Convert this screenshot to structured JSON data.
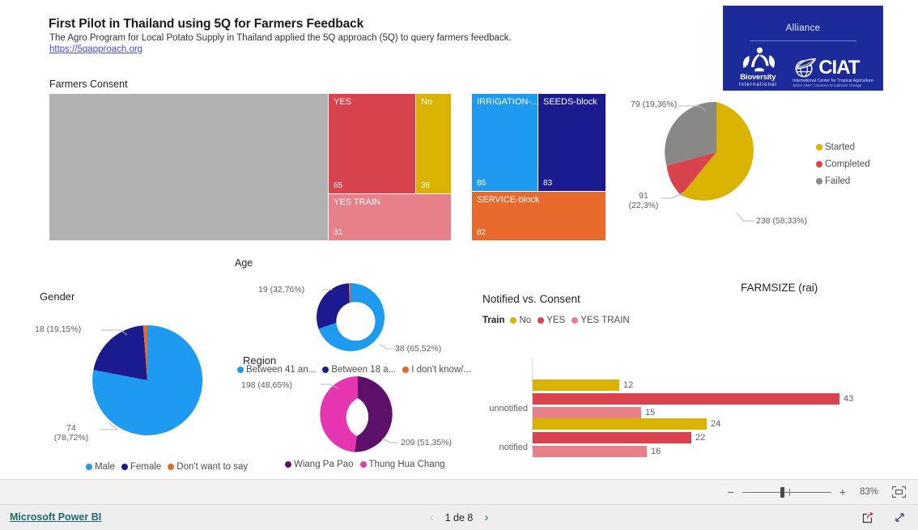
{
  "header": {
    "title": "First Pilot in Thailand using 5Q for Farmers Feedback",
    "subtitle": "The Agro Program for Local Potato Supply in Thailand applied the 5Q approach (5Q) to query farmers feedback.",
    "link": "https://5qapproach.org"
  },
  "logo": {
    "alliance": "Alliance",
    "bioversity_name": "Bioversity",
    "bioversity_sub": "International",
    "ciat_word": "CIAT",
    "ciat_sub1": "International Center for Tropical Agriculture",
    "ciat_sub2": "Since 1967 / Science to cultivate change"
  },
  "colors": {
    "red": "#D8434E",
    "red_light": "#E8808A",
    "gold": "#D9B300",
    "gray": "#B2B2B2",
    "blue_light": "#1E9BF0",
    "blue_dark": "#1B1B8F",
    "orange": "#E8692C",
    "purple_dark": "#5C1069",
    "magenta": "#E535B0",
    "brand_navy": "#1D2A99",
    "link_teal": "#1D6B72"
  },
  "farmers_consent": {
    "title": "Farmers Consent",
    "chart_data": {
      "type": "treemap",
      "title": "Farmers Consent",
      "categories": [
        "",
        "YES",
        "No",
        "YES TRAIN"
      ],
      "values": [
        null,
        65,
        36,
        31
      ],
      "colors": [
        "#B2B2B2",
        "#D8434E",
        "#D9B300",
        "#E8808A"
      ]
    }
  },
  "blocks_treemap": {
    "chart_data": {
      "type": "treemap",
      "title": "",
      "categories": [
        "IRRIGATION-...",
        "SEEDS-block",
        "SERVICE-block"
      ],
      "values": [
        86,
        83,
        82
      ],
      "colors": [
        "#1E9BF0",
        "#1B1B8F",
        "#E8692C"
      ]
    }
  },
  "status_pie": {
    "chart_data": {
      "type": "pie",
      "title": "",
      "categories": [
        "Started",
        "Completed",
        "Failed"
      ],
      "values": [
        238,
        91,
        79
      ],
      "labels": [
        "238 (58,33%)",
        "91\n(22,3%)",
        "79 (19,36%)"
      ],
      "colors": [
        "#D9B300",
        "#D8434E",
        "#8A8886"
      ],
      "legend_position": "right"
    },
    "legend": [
      "Started",
      "Completed",
      "Failed"
    ],
    "callout_started": "238 (58,33%)",
    "callout_completed_l1": "91",
    "callout_completed_l2": "(22,3%)",
    "callout_failed": "79 (19,36%)"
  },
  "gender": {
    "title": "Gender",
    "chart_data": {
      "type": "pie",
      "title": "Gender",
      "categories": [
        "Male",
        "Female",
        "Don't want to say"
      ],
      "values": [
        74,
        18,
        2
      ],
      "percents": [
        "78,72%",
        "19,15%",
        "2,13%"
      ],
      "colors": [
        "#1E9BF0",
        "#1B1B8F",
        "#E8692C"
      ],
      "legend_position": "bottom"
    },
    "callout_male_l1": "74",
    "callout_male_l2": "(78,72%)",
    "callout_female": "18 (19,15%)",
    "legend": [
      "Male",
      "Female",
      "Don't want to say"
    ]
  },
  "age": {
    "title": "Age",
    "chart_data": {
      "type": "pie",
      "title": "Age",
      "categories": [
        "Between 41 an...",
        "Between 18 a...",
        "I don't know/..."
      ],
      "values": [
        38,
        19,
        1
      ],
      "percents": [
        "65,52%",
        "32,76%",
        "1,72%"
      ],
      "colors": [
        "#1E9BF0",
        "#1B1B8F",
        "#E8692C"
      ],
      "legend_position": "bottom",
      "donut": true
    },
    "callout_a": "38 (65,52%)",
    "callout_b": "19 (32,76%)",
    "legend": [
      "Between 41 an...",
      "Between 18 a...",
      "I don't know/..."
    ]
  },
  "region": {
    "title": "Region",
    "chart_data": {
      "type": "pie",
      "title": "Region",
      "categories": [
        "Wiang Pa Pao",
        "Thung Hua Chang"
      ],
      "values": [
        209,
        198
      ],
      "percents": [
        "51,35%",
        "48,65%"
      ],
      "colors": [
        "#5C1069",
        "#E535B0"
      ],
      "legend_position": "bottom",
      "donut": true
    },
    "callout_wiang": "209 (51,35%)",
    "callout_thung": "198 (48,65%)",
    "legend": [
      "Wiang Pa Pao",
      "Thung Hua Chang"
    ]
  },
  "notified": {
    "title": "Notified vs. Consent",
    "legend_title": "Train",
    "chart_data": {
      "type": "bar",
      "title": "Notified vs. Consent",
      "orientation": "horizontal",
      "categories": [
        "unnotified",
        "notified"
      ],
      "series": [
        {
          "name": "No",
          "values": [
            12,
            24
          ],
          "color": "#D9B300"
        },
        {
          "name": "YES",
          "values": [
            43,
            22
          ],
          "color": "#D8434E"
        },
        {
          "name": "YES TRAIN",
          "values": [
            15,
            16
          ],
          "color": "#E8808A"
        }
      ],
      "legend_position": "top",
      "grid": false
    }
  },
  "farmsize": {
    "title": "FARMSIZE (rai)"
  },
  "toolbar": {
    "zoom_minus": "−",
    "zoom_plus": "+",
    "zoom_percent": "83%",
    "fit_icon": "fit-to-page-icon"
  },
  "footer": {
    "brand": "Microsoft Power BI",
    "page_label": "1 de 8",
    "prev_icon": "‹",
    "next_icon": "›",
    "share_icon": "share-icon",
    "fullscreen_icon": "fullscreen-icon"
  }
}
